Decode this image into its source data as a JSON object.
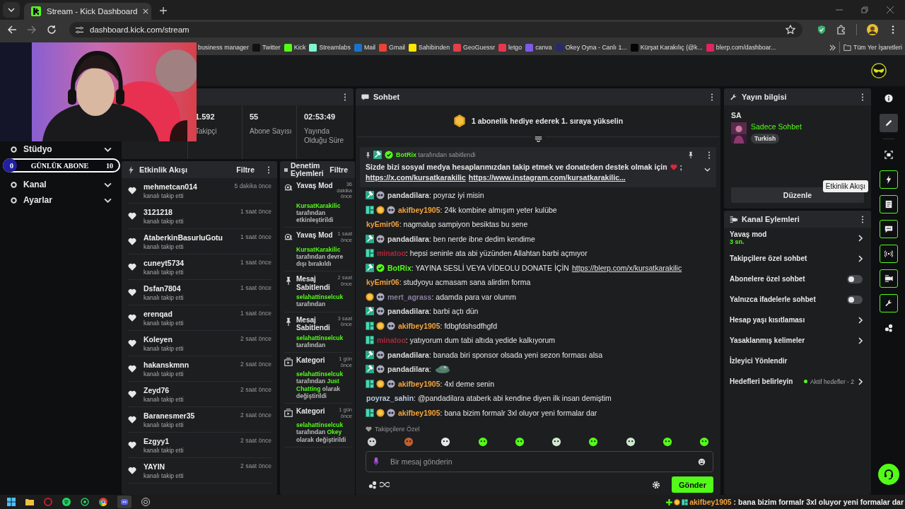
{
  "browser": {
    "tab": {
      "title": "Stream - Kick Dashboard"
    },
    "url": "dashboard.kick.com/stream",
    "bookmarks": [
      {
        "label": "business manager"
      },
      {
        "label": "Twitter",
        "color": "#111111"
      },
      {
        "label": "Kick",
        "color": "#53fc18"
      },
      {
        "label": "Streamlabs",
        "color": "#80f5d2"
      },
      {
        "label": "Mail",
        "color": "#1a73c8"
      },
      {
        "label": "Gmail",
        "color": "#ea4335"
      },
      {
        "label": "Sahibinden",
        "color": "#ffe800"
      },
      {
        "label": "GeoGuessr",
        "color": "#e0404a"
      },
      {
        "label": "letgo",
        "color": "#e8364f"
      },
      {
        "label": "canva",
        "color": "#7d5ae8"
      },
      {
        "label": "Okey Oyna - Canlı 1...",
        "color": "#2a2a6a"
      },
      {
        "label": "Kürşat Karakılıç (@k...",
        "color": "#050505"
      },
      {
        "label": "blerp.com/dashboar...",
        "color": "#e0245e"
      }
    ],
    "all_bookmarks": "Tüm Yer İşaretleri"
  },
  "overlay": {
    "label": "GÜNLÜK ABONE",
    "start": "0",
    "end": "10",
    "level": 0
  },
  "nav": [
    {
      "label": "Stüdyo"
    },
    {
      "label": "Kanal"
    },
    {
      "label": "Ayarlar"
    }
  ],
  "stats": [
    {
      "value": "1.592",
      "label": "Takipçi"
    },
    {
      "value": "55",
      "label": "Abone Sayısı"
    },
    {
      "value": "02:53:49",
      "label": "Yayında Olduğu Süre"
    }
  ],
  "activity": {
    "title": "Etkinlik Akışı",
    "filter": "Filtre",
    "items": [
      {
        "name": "mehmetcan014",
        "action": "kanalı takip etti",
        "time": "5 dakika önce"
      },
      {
        "name": "3121218",
        "action": "kanalı takip etti",
        "time": "1 saat önce"
      },
      {
        "name": "AtaberkinBasurluGotu",
        "action": "kanalı takip etti",
        "time": "1 saat önce"
      },
      {
        "name": "cuneyt5734",
        "action": "kanalı takip etti",
        "time": "1 saat önce"
      },
      {
        "name": "Dsfan7804",
        "action": "kanalı takip etti",
        "time": "1 saat önce"
      },
      {
        "name": "erenqad",
        "action": "kanalı takip etti",
        "time": "1 saat önce"
      },
      {
        "name": "Koleyen",
        "action": "kanalı takip etti",
        "time": "2 saat önce"
      },
      {
        "name": "hakanskmnn",
        "action": "kanalı takip etti",
        "time": "2 saat önce"
      },
      {
        "name": "Zeyd76",
        "action": "kanalı takip etti",
        "time": "2 saat önce"
      },
      {
        "name": "Baranesmer35",
        "action": "kanalı takip etti",
        "time": "2 saat önce"
      },
      {
        "name": "Ezgyy1",
        "action": "kanalı takip etti",
        "time": "2 saat önce"
      },
      {
        "name": "YAYIN",
        "action": "kanalı takip etti",
        "time": "2 saat önce"
      }
    ]
  },
  "moderation": {
    "title": "Denetim Eylemleri",
    "filter": "Filtre",
    "items": [
      {
        "kind": "slow",
        "title": "Yavaş Mod",
        "time": "36 dakika önce",
        "segments": [
          {
            "text": "KursatKarakilic",
            "accent": true
          },
          {
            "text": " tarafından etkinleştirildi",
            "accent": false
          }
        ]
      },
      {
        "kind": "slow",
        "title": "Yavaş Mod",
        "time": "1 saat önce",
        "segments": [
          {
            "text": "KursatKarakilic",
            "accent": true
          },
          {
            "text": " tarafından devre dışı bırakıldı",
            "accent": false
          }
        ]
      },
      {
        "kind": "pin",
        "title": "Mesaj Sabitlendi",
        "time": "2 saat önce",
        "segments": [
          {
            "text": "selahattinselcuk",
            "accent": true
          },
          {
            "text": " tarafından",
            "accent": false
          }
        ]
      },
      {
        "kind": "pin",
        "title": "Mesaj Sabitlendi",
        "time": "3 saat önce",
        "segments": [
          {
            "text": "selahattinselcuk",
            "accent": true
          },
          {
            "text": " tarafından",
            "accent": false
          }
        ]
      },
      {
        "kind": "category",
        "title": "Kategori",
        "time": "1 gün önce",
        "segments": [
          {
            "text": "selahattinselcuk",
            "accent": true
          },
          {
            "text": " tarafından ",
            "accent": false
          },
          {
            "text": "Just Chatting",
            "accent": true
          },
          {
            "text": " olarak değiştirildi",
            "accent": false
          }
        ]
      },
      {
        "kind": "category",
        "title": "Kategori",
        "time": "1 gün önce",
        "segments": [
          {
            "text": "selahattinselcuk",
            "accent": true
          },
          {
            "text": " tarafından ",
            "accent": false
          },
          {
            "text": "Okey",
            "accent": true
          },
          {
            "text": " olarak değiştirildi",
            "accent": false
          }
        ]
      }
    ]
  },
  "chat": {
    "title": "Sohbet",
    "gift_banner": "1 abonelik hediye ederek 1. sıraya yükselin",
    "pinned": {
      "by": "BotRix",
      "by_suffix": " tarafından sabitlendi",
      "text": "Sizde bizi sosyal medya hesaplarımızdan takip etmek ve donateden destek olmak için",
      "after_icon": ";",
      "links": [
        "https://x.com/kursatkarakilic",
        "https://www.instagram.com/kursatkarakilic..."
      ]
    },
    "messages": [
      {
        "kind": "text",
        "user": "pandadilara",
        "color": "#dddddd",
        "badges": [
          {
            "kind": "mod"
          },
          {
            "kind": "face"
          }
        ],
        "text": ": poyraz iyi misin"
      },
      {
        "kind": "text",
        "user": "akifbey1905",
        "color": "#f5a43a",
        "badges": [
          {
            "kind": "og"
          },
          {
            "kind": "sub"
          },
          {
            "kind": "face"
          }
        ],
        "text": ": 24k kombine almışım yeter kulübe"
      },
      {
        "kind": "text",
        "user": "kyEmir06",
        "color": "#f0a040",
        "text": ": nagmalup sampiyon besiktas bu sene"
      },
      {
        "kind": "text",
        "user": "pandadilara",
        "color": "#dddddd",
        "badges": [
          {
            "kind": "mod"
          },
          {
            "kind": "face"
          }
        ],
        "text": ": ben nerde ibne dedim kendime"
      },
      {
        "kind": "text",
        "user": "minatoo",
        "color": "#a8283a",
        "badges": [
          {
            "kind": "og"
          }
        ],
        "text": ": hepsi seninle ata abi yüzünden Allahtan barbi açmıyor"
      },
      {
        "kind": "text",
        "user": "BotRix",
        "color": "#53fc18",
        "badges": [
          {
            "kind": "mod"
          },
          {
            "kind": "verified"
          }
        ],
        "text": ": YAYINA SESLİ VEYA VİDEOLU DONATE İÇİN",
        "link": "https://blerp.com/x/kursatkarakilic"
      },
      {
        "kind": "text",
        "user": "kyEmir06",
        "color": "#f0a040",
        "text": ": studyoyu acmasam sana alirdim forma"
      },
      {
        "kind": "text",
        "user": "mert_agrass",
        "color": "#8b7fa0",
        "badges": [
          {
            "kind": "sub"
          },
          {
            "kind": "face"
          }
        ],
        "text": ": adamda para var olumm"
      },
      {
        "kind": "text",
        "user": "pandadilara",
        "color": "#dddddd",
        "badges": [
          {
            "kind": "mod"
          },
          {
            "kind": "face"
          }
        ],
        "text": ": barbi açtı dün"
      },
      {
        "kind": "text",
        "user": "akifbey1905",
        "color": "#f5a43a",
        "badges": [
          {
            "kind": "og"
          },
          {
            "kind": "sub"
          },
          {
            "kind": "face"
          }
        ],
        "text": ": fdbgfdshsdfhgfd"
      },
      {
        "kind": "text",
        "user": "minatoo",
        "color": "#a8283a",
        "badges": [
          {
            "kind": "og"
          }
        ],
        "text": ": yatıyorum dum tabi altıda yedide kalkıyorum"
      },
      {
        "kind": "text",
        "user": "pandadilara",
        "color": "#dddddd",
        "badges": [
          {
            "kind": "mod"
          },
          {
            "kind": "face"
          }
        ],
        "text": ": banada biri sponsor olsada yeni sezon forması alsa"
      },
      {
        "kind": "emote",
        "user": "pandadilara",
        "color": "#dddddd",
        "badges": [
          {
            "kind": "mod"
          },
          {
            "kind": "face"
          }
        ],
        "text": ":"
      },
      {
        "kind": "text",
        "user": "akifbey1905",
        "color": "#f5a43a",
        "badges": [
          {
            "kind": "og"
          },
          {
            "kind": "sub"
          },
          {
            "kind": "face"
          }
        ],
        "text": ": 4xl deme senin"
      },
      {
        "kind": "text",
        "user": "poyraz_sahin",
        "color": "#b8c8e0",
        "text": ": @pandadilara ataberk abi kendine diyen ilk insan demiştim"
      },
      {
        "kind": "text",
        "user": "akifbey1905",
        "color": "#f5a43a",
        "badges": [
          {
            "kind": "og"
          },
          {
            "kind": "sub"
          },
          {
            "kind": "face"
          }
        ],
        "text": ": bana bizim formalr 3xl oluyor yeni formalar dar"
      }
    ],
    "followers_only_label": "Takipçilere Özel",
    "input": {
      "placeholder": "Bir mesaj gönderin"
    },
    "send": "Gönder"
  },
  "stream_info": {
    "title": "Yayın bilgisi",
    "stream_title": "SA",
    "category": "Sadece Sohbet",
    "tag": "Turkish",
    "edit": "Düzenle"
  },
  "channel_actions": {
    "title": "Kanal Eylemleri",
    "items": [
      {
        "kind": "link",
        "label": "Yavaş mod",
        "detail": "3 sn."
      },
      {
        "kind": "link",
        "label": "Takipçilere özel sohbet"
      },
      {
        "kind": "toggle",
        "label": "Abonelere özel sohbet",
        "on": false
      },
      {
        "kind": "toggle",
        "label": "Yalnızca ifadelerle sohbet",
        "on": false
      },
      {
        "kind": "link",
        "label": "Hesap yaşı kısıtlaması"
      },
      {
        "kind": "link",
        "label": "Yasaklanmış kelimeler"
      },
      {
        "kind": "plain",
        "label": "İzleyici Yönlendir"
      },
      {
        "kind": "goal",
        "label": "Hedefleri belirleyin",
        "detail": "Aktif hedefler - 2"
      }
    ]
  },
  "rail": [
    {
      "selected": false,
      "active": false
    },
    {
      "selected": true,
      "active": false
    },
    {
      "selected": false,
      "active": false
    },
    {
      "selected": false,
      "active": true
    },
    {
      "selected": false,
      "active": true
    },
    {
      "selected": false,
      "active": true
    },
    {
      "selected": false,
      "active": true
    },
    {
      "selected": false,
      "active": true
    },
    {
      "selected": false,
      "active": true
    },
    {
      "selected": false,
      "active": false
    }
  ],
  "rail_tooltip": "Etkinlik Akışı",
  "taskbar": {
    "ticker_user": "akifbey1905",
    "ticker_text": " : bana bizim formalr 3xl oluyor yeni formalar dar"
  }
}
